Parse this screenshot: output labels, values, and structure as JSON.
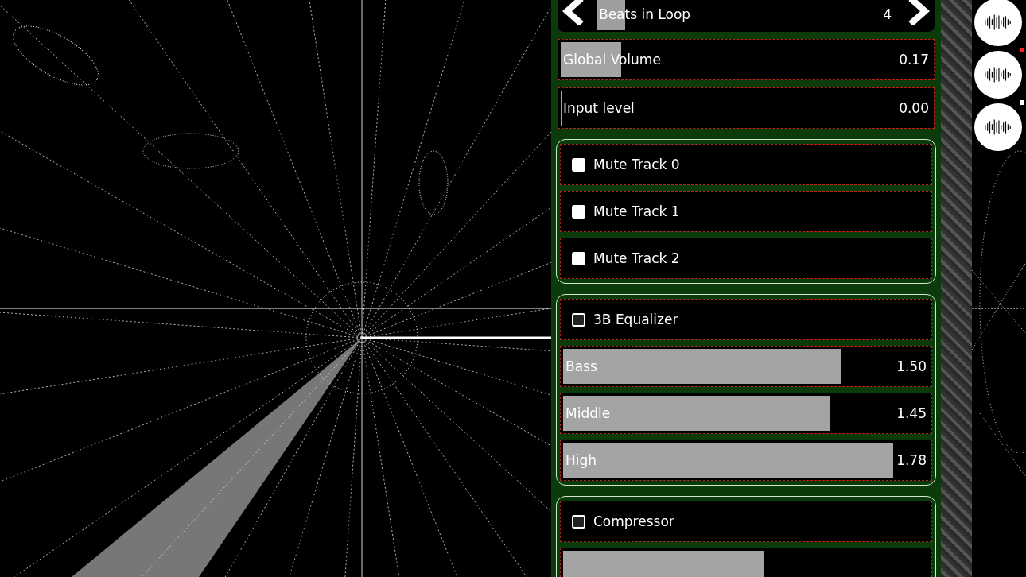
{
  "controls": [
    {
      "kind": "stepper",
      "label": "Beats in Loop",
      "value": "4",
      "level": 0.09
    },
    {
      "kind": "slider",
      "label": "Global Volume",
      "value": "0.17",
      "level": 0.16
    },
    {
      "kind": "slider",
      "label": "Input level",
      "value": "0.00",
      "level": 0
    }
  ],
  "groups": [
    {
      "items": [
        {
          "kind": "checkbox",
          "label": "Mute Track 0",
          "checked": false
        },
        {
          "kind": "checkbox",
          "label": "Mute Track 1",
          "checked": false
        },
        {
          "kind": "checkbox",
          "label": "Mute Track 2",
          "checked": false
        }
      ]
    },
    {
      "items": [
        {
          "kind": "toggle",
          "label": "3B Equalizer",
          "checked": false
        },
        {
          "kind": "slider",
          "label": "Bass",
          "value": "1.50",
          "level": 0.75
        },
        {
          "kind": "slider",
          "label": "Middle",
          "value": "1.45",
          "level": 0.72
        },
        {
          "kind": "slider",
          "label": "High",
          "value": "1.78",
          "level": 0.89
        }
      ]
    },
    {
      "items": [
        {
          "kind": "toggle",
          "label": "Compressor",
          "checked": false
        },
        {
          "kind": "slider",
          "level": 0.54
        }
      ]
    }
  ],
  "track_buttons": [
    {
      "kind": "waveform"
    },
    {
      "kind": "waveform",
      "color": "#ff2020"
    },
    {
      "kind": "waveform",
      "color": "#ffffff"
    }
  ]
}
